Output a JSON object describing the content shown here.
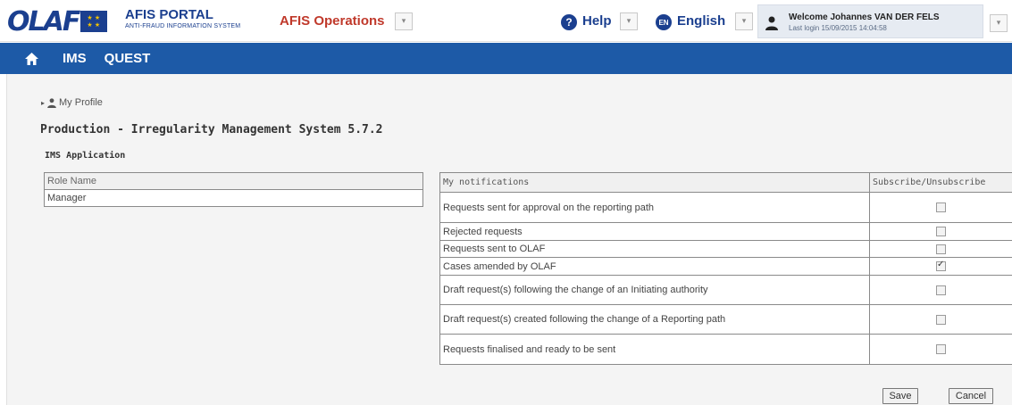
{
  "header": {
    "logo_text": "OLAF",
    "portal_title": "AFIS PORTAL",
    "portal_subtitle": "ANTI-FRAUD INFORMATION SYSTEM",
    "operations_label": "AFIS Operations",
    "help_label": "Help",
    "language_label": "English",
    "welcome_text": "Welcome Johannes VAN DER FELS",
    "last_login_text": "Last login 15/09/2015 14:04:58"
  },
  "nav": {
    "items": [
      {
        "label": "IMS"
      },
      {
        "label": "QUEST"
      }
    ]
  },
  "content": {
    "profile_link": "My Profile",
    "page_title": "Production - Irregularity Management System 5.7.2",
    "section_title": "IMS Application",
    "roles_table": {
      "header": "Role Name",
      "rows": [
        "Manager"
      ]
    },
    "notifications_table": {
      "col_name": "My notifications",
      "col_subscribe": "Subscribe/Unsubscribe",
      "rows": [
        {
          "label": "Requests sent for approval on the reporting path",
          "checked": false
        },
        {
          "label": "Rejected requests",
          "checked": false
        },
        {
          "label": "Requests sent to OLAF",
          "checked": false
        },
        {
          "label": "Cases amended by OLAF",
          "checked": true
        },
        {
          "label": "Draft request(s) following the change of an Initiating authority",
          "checked": false
        },
        {
          "label": "Draft request(s) created following the change of a Reporting path",
          "checked": false
        },
        {
          "label": "Requests finalised and ready to be sent",
          "checked": false
        }
      ]
    },
    "save_label": "Save",
    "cancel_label": "Cancel"
  },
  "colors": {
    "brand_blue": "#1d5aa7",
    "operations_red": "#c0392b"
  }
}
